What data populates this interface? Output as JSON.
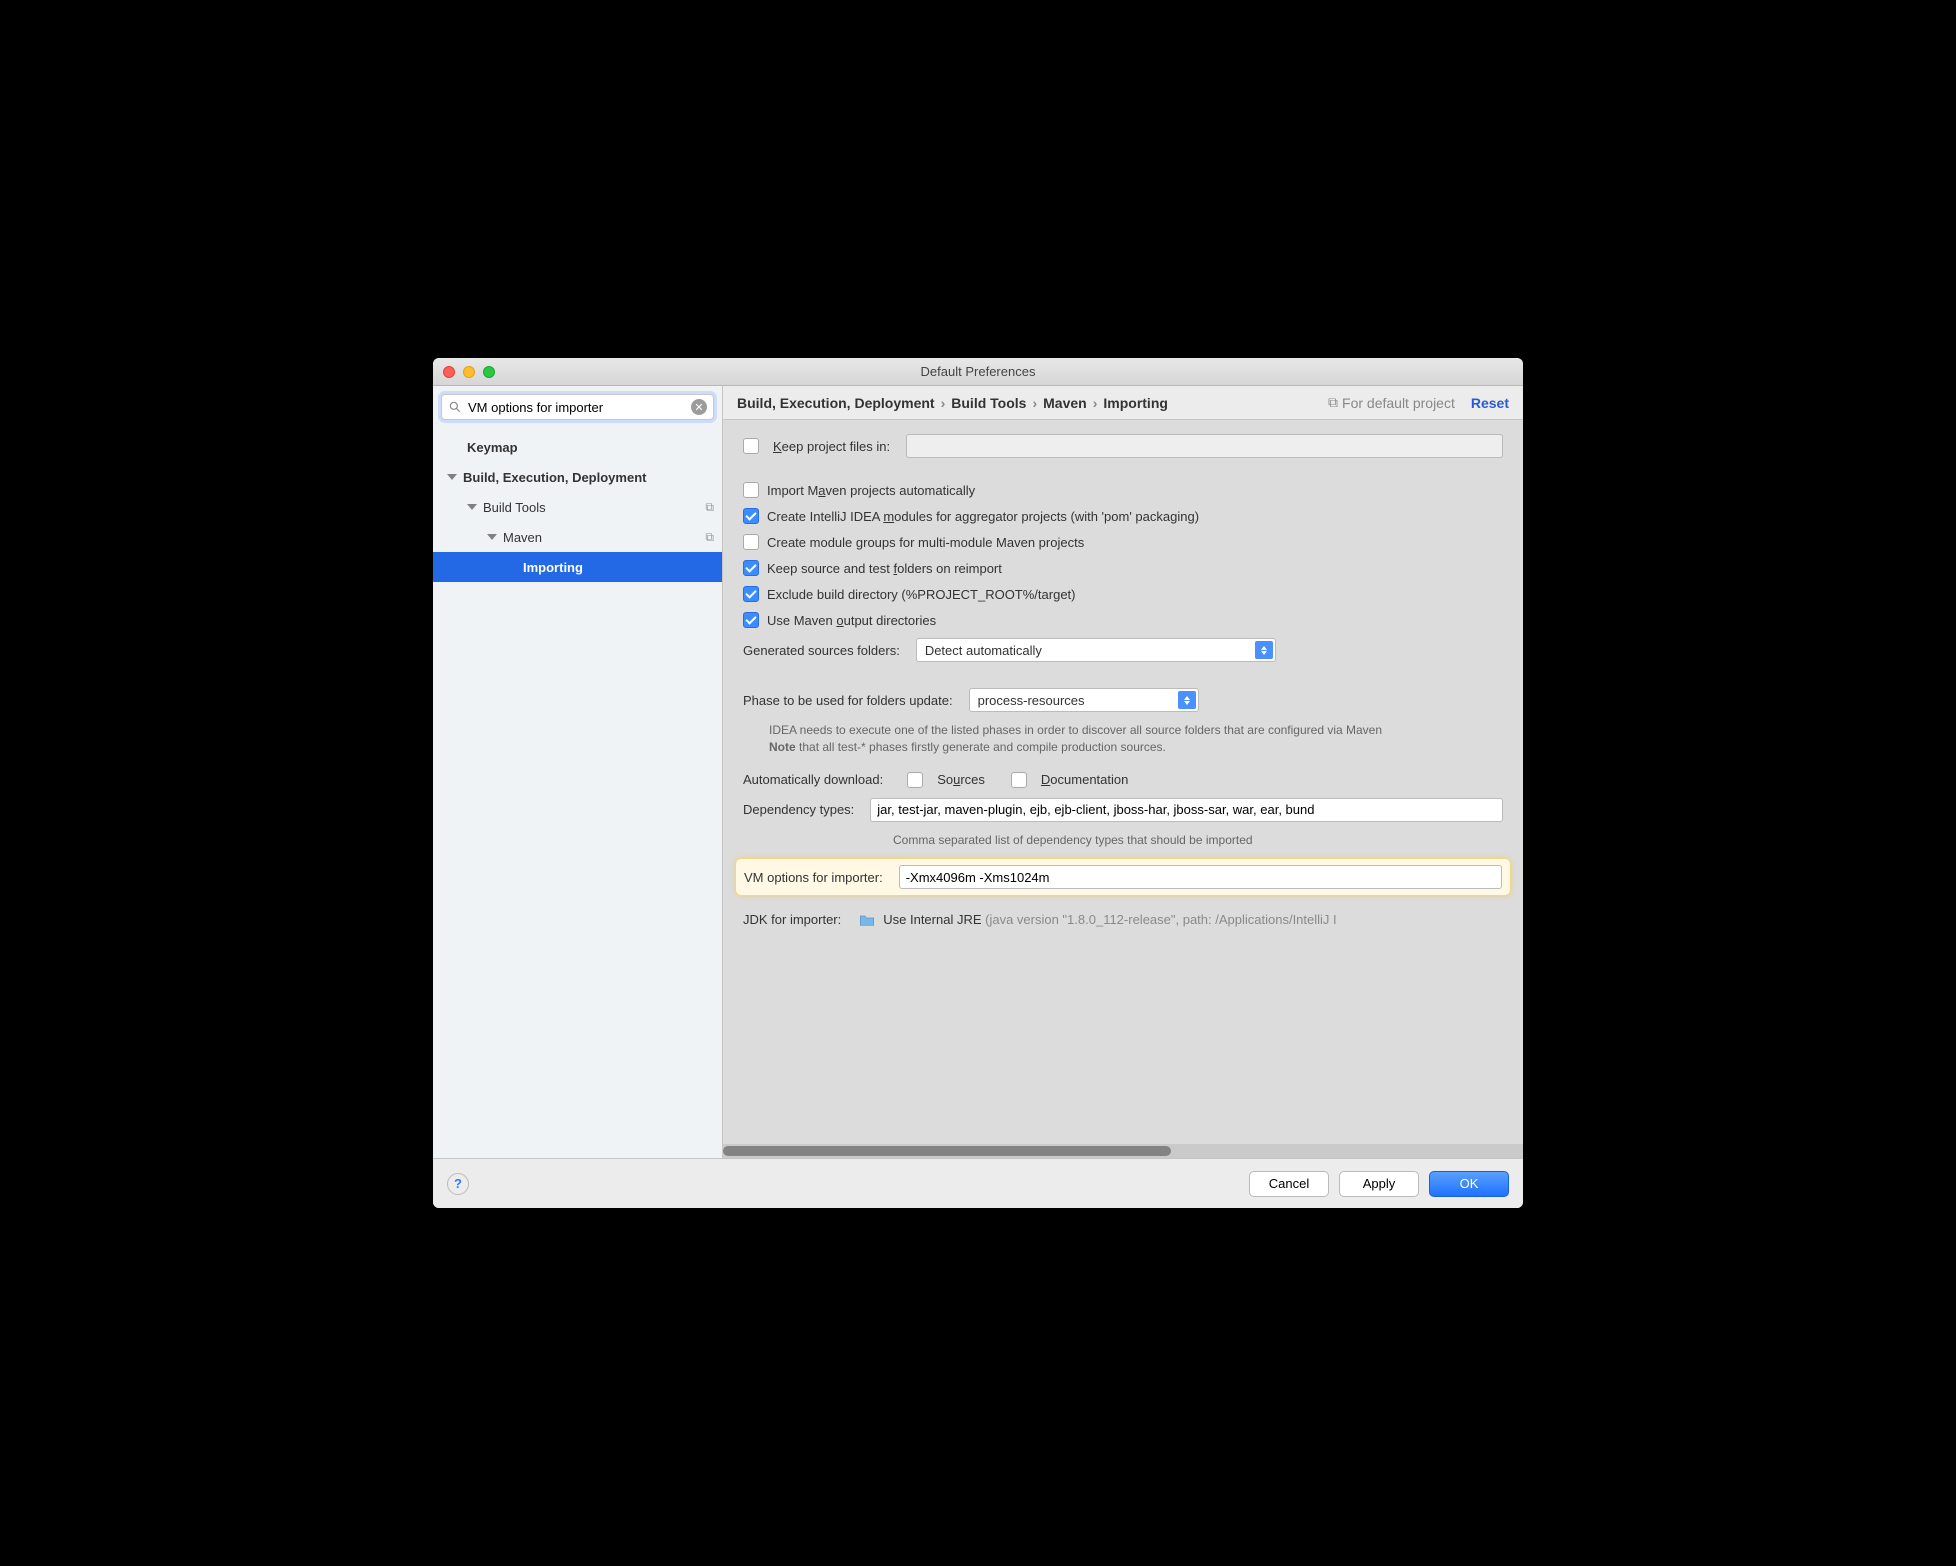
{
  "window": {
    "title": "Default Preferences"
  },
  "search": {
    "value": "VM options for importer"
  },
  "sidebar": {
    "items": [
      {
        "label": "Keymap",
        "indent": 26,
        "bold": true,
        "disclosure": false
      },
      {
        "label": "Build, Execution, Deployment",
        "indent": 6,
        "bold": true,
        "disclosure": true
      },
      {
        "label": "Build Tools",
        "indent": 26,
        "bold": false,
        "disclosure": true,
        "copy": true
      },
      {
        "label": "Maven",
        "indent": 46,
        "bold": false,
        "disclosure": true,
        "copy": true
      },
      {
        "label": "Importing",
        "indent": 82,
        "bold": true,
        "disclosure": false,
        "selected": true
      }
    ]
  },
  "breadcrumb": {
    "parts": [
      "Build, Execution, Deployment",
      "Build Tools",
      "Maven",
      "Importing"
    ],
    "for_project": "For default project",
    "reset": "Reset"
  },
  "form": {
    "keep_files_label": "Keep project files in:",
    "keep_files_value": "",
    "cb_import_auto": "Import Maven projects automatically",
    "cb_aggregator": "Create IntelliJ IDEA modules for aggregator projects (with 'pom' packaging)",
    "cb_module_groups": "Create module groups for multi-module Maven projects",
    "cb_keep_folders": "Keep source and test folders on reimport",
    "cb_exclude_build": "Exclude build directory (%PROJECT_ROOT%/target)",
    "cb_output_dirs": "Use Maven output directories",
    "gen_sources_label": "Generated sources folders:",
    "gen_sources_value": "Detect automatically",
    "phase_label": "Phase to be used for folders update:",
    "phase_value": "process-resources",
    "phase_hint1": "IDEA needs to execute one of the listed phases in order to discover all source folders that are configured via Maven",
    "phase_hint2_bold": "Note",
    "phase_hint2_rest": " that all test-* phases firstly generate and compile production sources.",
    "auto_dl_label": "Automatically download:",
    "auto_dl_sources": "Sources",
    "auto_dl_docs": "Documentation",
    "dep_types_label": "Dependency types:",
    "dep_types_value": "jar, test-jar, maven-plugin, ejb, ejb-client, jboss-har, jboss-sar, war, ear, bund",
    "dep_types_hint": "Comma separated list of dependency types that should be imported",
    "vm_label": "VM options for importer:",
    "vm_value": "-Xmx4096m -Xms1024m",
    "jdk_label": "JDK for importer:",
    "jdk_value": "Use Internal JRE ",
    "jdk_detail": "(java version \"1.8.0_112-release\", path: /Applications/IntelliJ I"
  },
  "footer": {
    "cancel": "Cancel",
    "apply": "Apply",
    "ok": "OK"
  }
}
